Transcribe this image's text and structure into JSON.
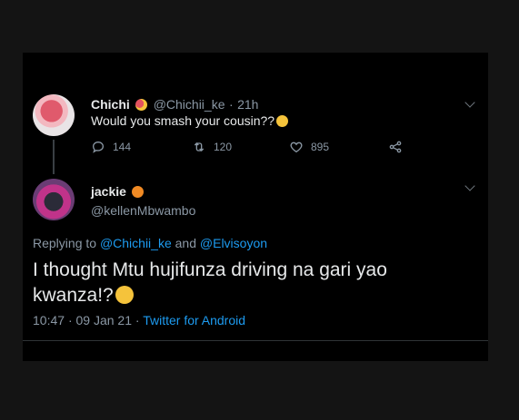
{
  "tweet1": {
    "display_name": "Chichi",
    "handle": "@Chichii_ke",
    "time": "21h",
    "separator": "·",
    "text": "Would you smash your cousin??",
    "replies": "144",
    "retweets": "120",
    "likes": "895"
  },
  "tweet2": {
    "display_name": "jackie",
    "handle": "@kellenMbwambo",
    "replying_prefix": "Replying to",
    "replying_user1": "@Chichii_ke",
    "replying_and": "and",
    "replying_user2": "@Elvisoyon",
    "text": "I thought Mtu hujifunza driving na gari yao kwanza!?",
    "time": "10:47",
    "date": "09 Jan 21",
    "separator": "·",
    "source": "Twitter for Android"
  },
  "colors": {
    "background": "#000000",
    "text": "#e7e9ea",
    "muted": "#8b98a5",
    "link": "#1d9bf0"
  },
  "icons": [
    "reply-icon",
    "retweet-icon",
    "like-icon",
    "share-icon",
    "chevron-down-icon"
  ]
}
